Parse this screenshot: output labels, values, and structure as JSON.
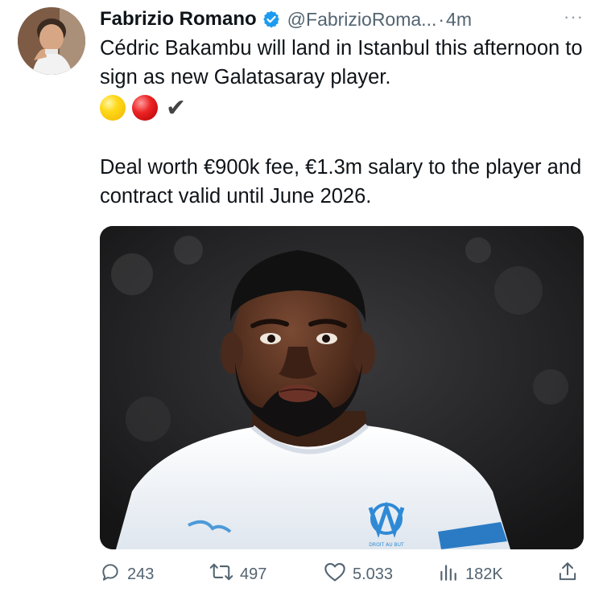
{
  "tweet": {
    "author_name": "Fabrizio Romano",
    "handle": "@FabrizioRoma...",
    "separator": "·",
    "time": "4m",
    "more_label": "···",
    "text_line1": "Cédric Bakambu will land in Istanbul this afternoon to sign as new Galatasaray player.",
    "emoji_check": "✔",
    "text_line2": "Deal worth €900k fee, €1.3m salary to the player and contract valid until June 2026."
  },
  "icons": {
    "verified": "verified-badge-icon",
    "reply": "reply-icon",
    "retweet": "retweet-icon",
    "like": "like-icon",
    "views": "views-icon",
    "share": "share-icon"
  },
  "media": {
    "shirt_text": "DROIT AU BUT"
  },
  "stats": {
    "replies": "243",
    "retweets": "497",
    "likes": "5.033",
    "views": "182K"
  },
  "colors": {
    "verified_blue": "#1d9bf0",
    "muted_text": "#536471"
  }
}
